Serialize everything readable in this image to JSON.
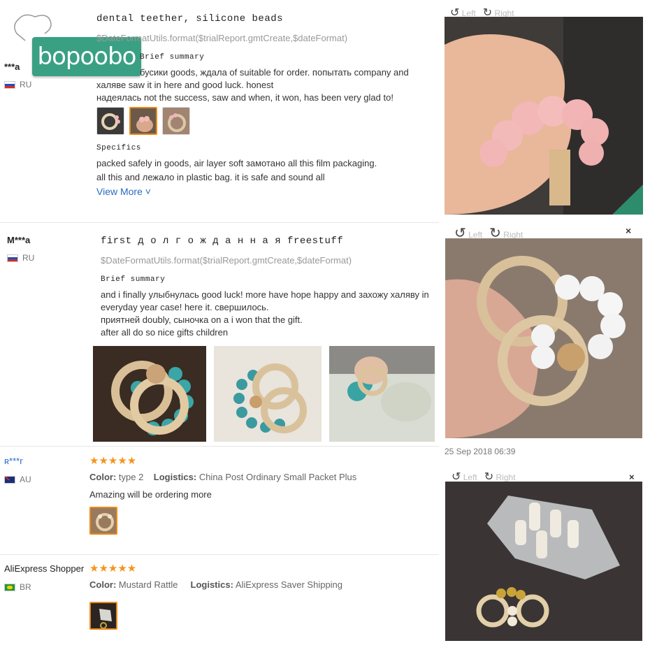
{
  "brand": {
    "logo_text": "bopoobo"
  },
  "reviews": [
    {
      "name": "***a",
      "country": "RU",
      "title": "dental teether, silicone beads",
      "date_template": "$DateFormatUtils.format($trialReport.gmtCreate,$dateFormat)",
      "summary_label": "Brief summary",
      "summary_lines": [
        "бусики goods, ждала of suitable for order. попытать company and",
        "халяве saw it in here and good luck. honest",
        "надеялась not the success, saw and when, it won, has been very glad to!"
      ],
      "specifics_label": "Specifics",
      "specifics_lines": [
        "packed safely in goods, air layer soft замотано all this film packaging.",
        "all this and лежало in plastic bag. it is safe and sound all"
      ],
      "view_more": "View More ˅"
    },
    {
      "name": "M***a",
      "country": "RU",
      "title": "first  д о л г о ж д а н н а я  freestuff",
      "date_template": "$DateFormatUtils.format($trialReport.gmtCreate,$dateFormat)",
      "summary_label": "Brief summary",
      "summary_lines": [
        "and i finally улыбнулась good luck! more have hope happy and захожу халяву in",
        "everyday year case! here it. свершилось.",
        "приятней doubly, сыночка on a i won that the gift.",
        "after all do so nice gifts children"
      ]
    },
    {
      "name": "ʀ***r",
      "country": "AU",
      "stars": "★★★★★",
      "color_label": "Color:",
      "color_value": "type 2",
      "logistics_label": "Logistics:",
      "logistics_value": "China Post Ordinary Small Packet Plus",
      "comment": "Amazing will be ordering more"
    },
    {
      "name": "AliExpress Shopper",
      "country": "BR",
      "stars": "★★★★★",
      "color_label": "Color:",
      "color_value": "Mustard Rattle",
      "logistics_label": "Logistics:",
      "logistics_value": "AliExpress Saver Shipping"
    }
  ],
  "viewer": {
    "left_label": "Left",
    "right_label": "Right",
    "close_symbol": "×",
    "timestamp": "25 Sep 2018 06:39"
  },
  "colors": {
    "brand_green": "#3aa083",
    "link_blue": "#2a6bc4",
    "star_orange": "#f5941e",
    "selected_orange": "#e88a1a"
  }
}
